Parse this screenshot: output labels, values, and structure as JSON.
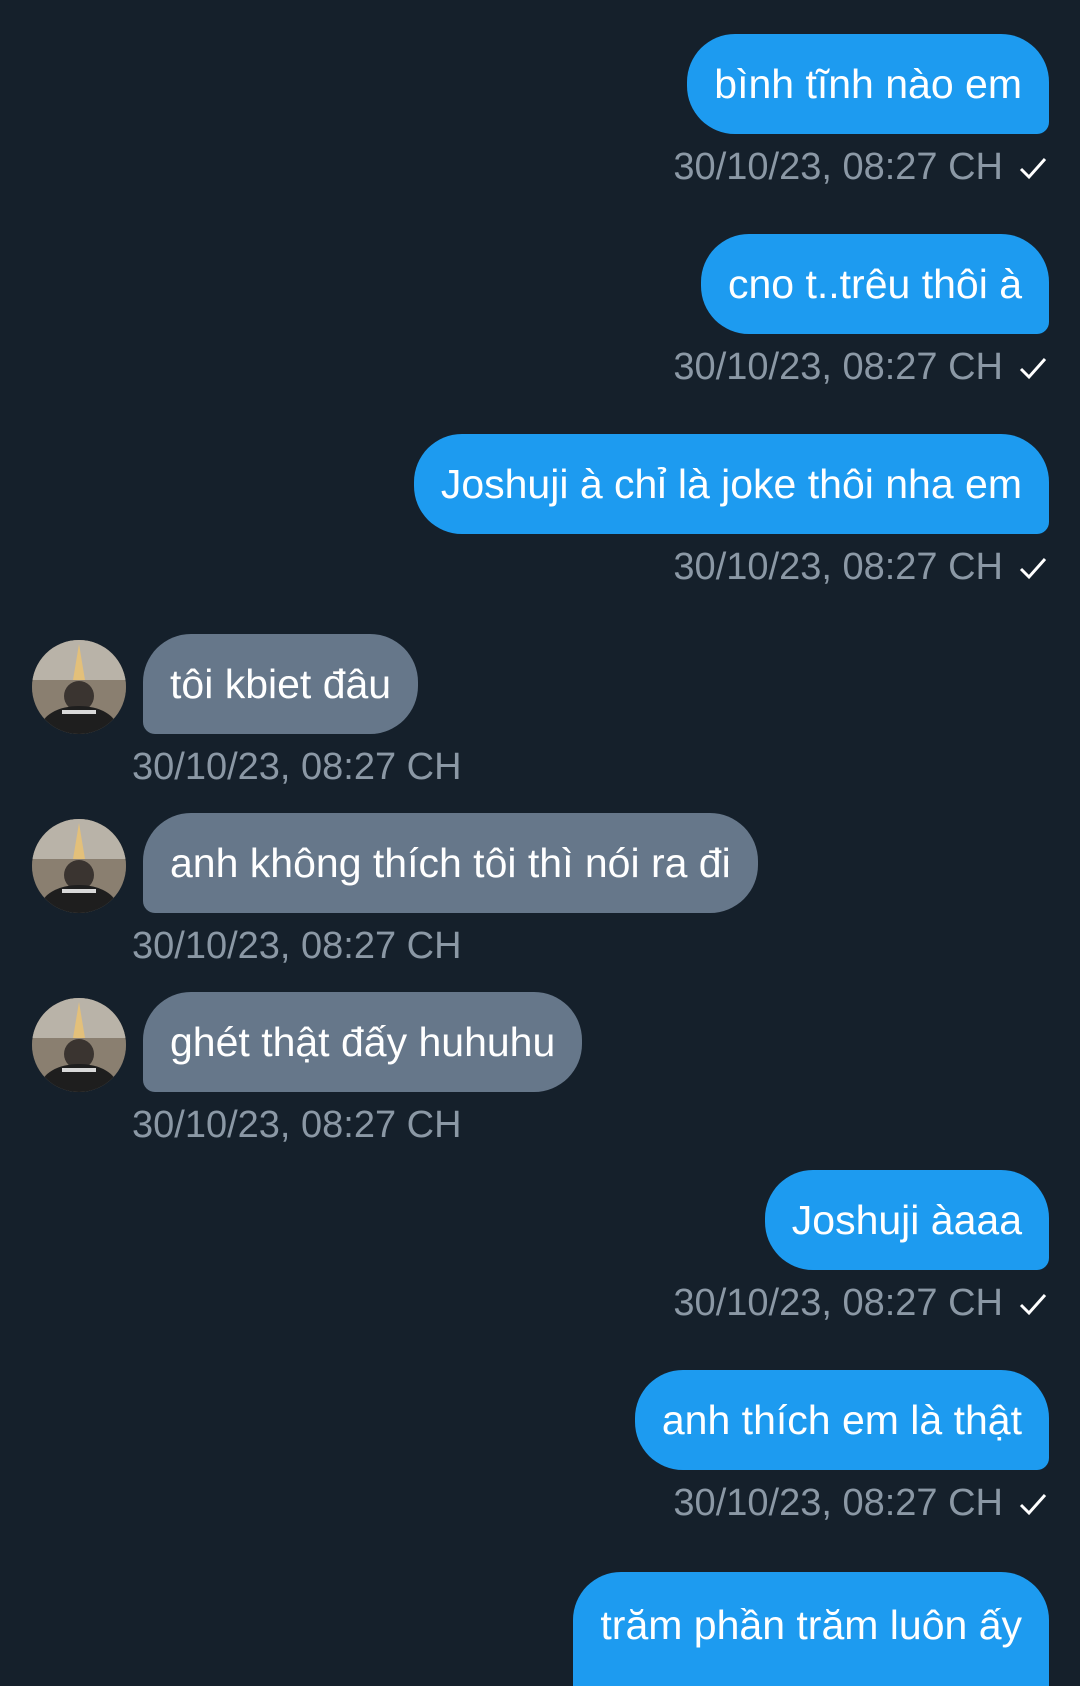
{
  "conversation": {
    "messages": [
      {
        "direction": "sent",
        "text": "bình tĩnh nào em",
        "timestamp": "30/10/23, 08:27 CH",
        "read": true
      },
      {
        "direction": "sent",
        "text": "cno t..trêu thôi à",
        "timestamp": "30/10/23, 08:27 CH",
        "read": true
      },
      {
        "direction": "sent",
        "text": "Joshuji à chỉ là joke thôi nha em",
        "timestamp": "30/10/23, 08:27 CH",
        "read": true
      },
      {
        "direction": "received",
        "text": "tôi kbiet đâu",
        "timestamp": "30/10/23, 08:27 CH"
      },
      {
        "direction": "received",
        "text": "anh không thích tôi thì nói ra đi",
        "timestamp": "30/10/23, 08:27 CH"
      },
      {
        "direction": "received",
        "text": "ghét thật đấy huhuhu",
        "timestamp": "30/10/23, 08:27 CH"
      },
      {
        "direction": "sent",
        "text": "Joshuji àaaa",
        "timestamp": "30/10/23, 08:27 CH",
        "read": true
      },
      {
        "direction": "sent",
        "text": "anh thích em là thật",
        "timestamp": "30/10/23, 08:27 CH",
        "read": true
      },
      {
        "direction": "sent",
        "text": "trăm phần trăm luôn ấy"
      }
    ]
  },
  "icons": {
    "read_receipt": "checkmark-icon",
    "avatar": "user-avatar-photo"
  },
  "colors": {
    "background": "#15202b",
    "sent_bubble": "#1d9bf0",
    "received_bubble": "#66778a",
    "timestamp_text": "#8b98a5",
    "message_text": "#ffffff"
  }
}
